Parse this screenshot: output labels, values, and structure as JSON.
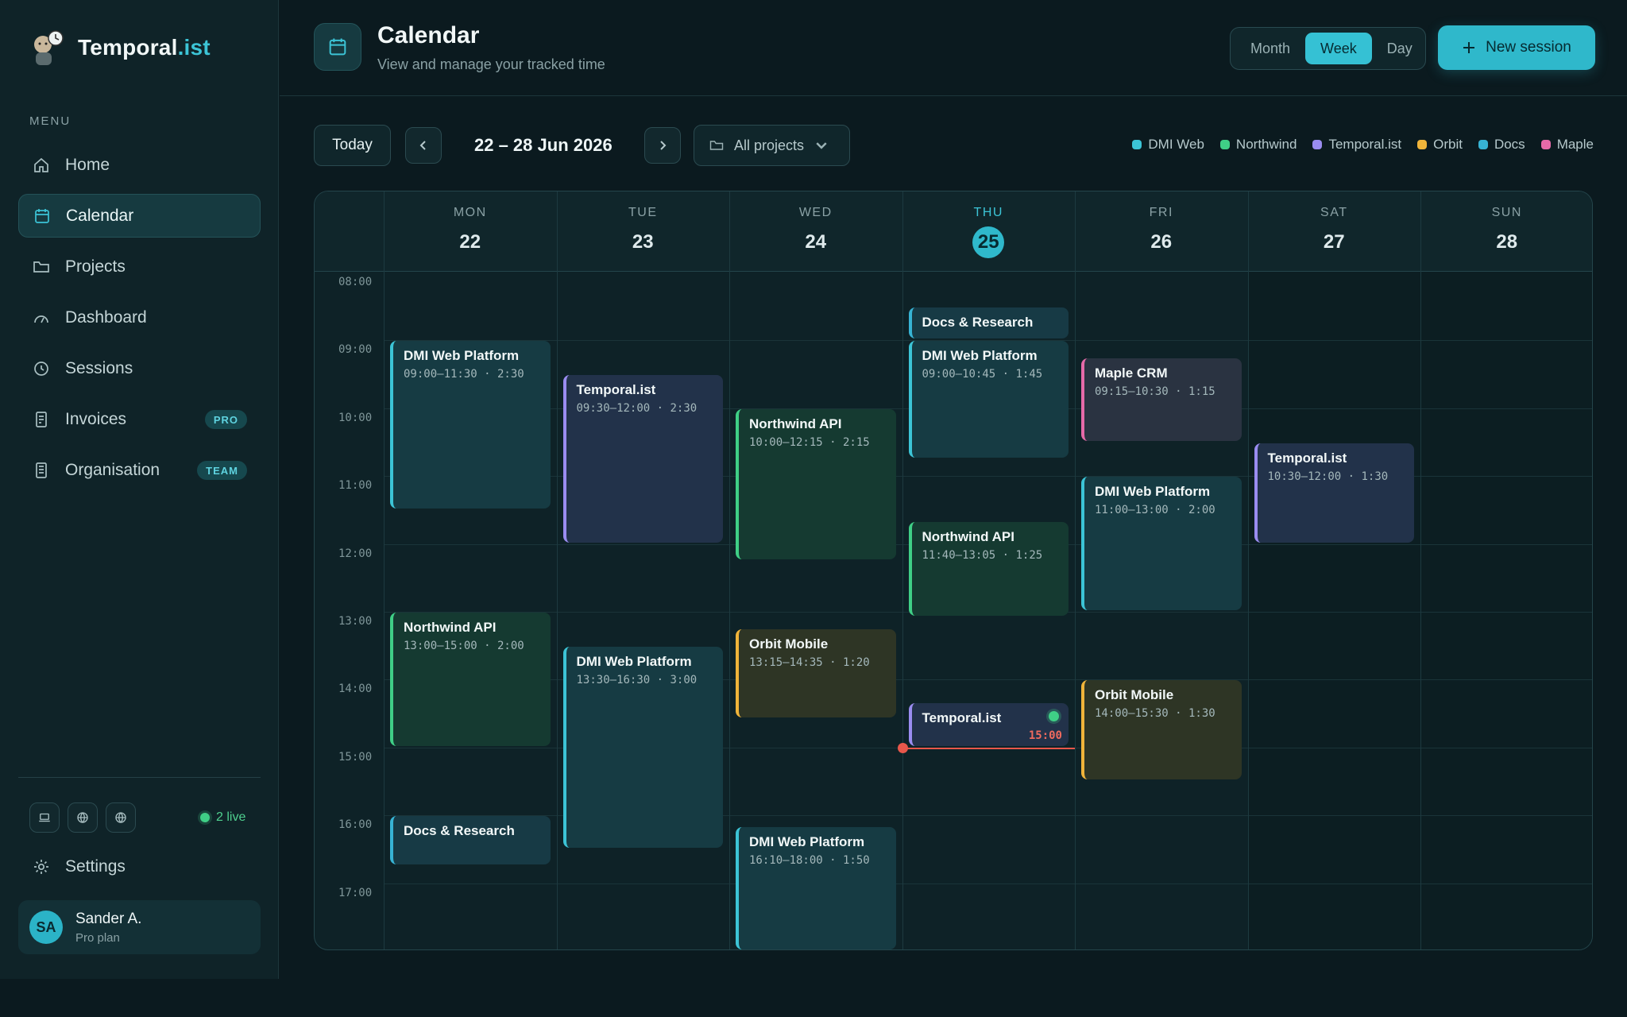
{
  "brand": {
    "name_main": "Temporal",
    "name_accent": ".ist"
  },
  "sidebar": {
    "menu_label": "MENU",
    "items": [
      {
        "label": "Home",
        "icon": "home-icon"
      },
      {
        "label": "Calendar",
        "icon": "calendar-icon",
        "active": true
      },
      {
        "label": "Projects",
        "icon": "folder-icon"
      },
      {
        "label": "Dashboard",
        "icon": "gauge-icon"
      },
      {
        "label": "Sessions",
        "icon": "clock-icon"
      },
      {
        "label": "Invoices",
        "icon": "invoice-icon",
        "badge": "PRO"
      },
      {
        "label": "Organisation",
        "icon": "building-icon",
        "badge": "TEAM"
      }
    ],
    "live_label": "2 live",
    "settings_label": "Settings",
    "user": {
      "initials": "SA",
      "name": "Sander A.",
      "plan": "Pro plan"
    }
  },
  "header": {
    "title": "Calendar",
    "subtitle": "View and manage your tracked time",
    "views": [
      "Month",
      "Week",
      "Day"
    ],
    "active_view": "Week",
    "new_session": "New session"
  },
  "toolbar": {
    "today": "Today",
    "range": "22 – 28 Jun 2026",
    "project_filter": "All projects"
  },
  "legend": [
    {
      "label": "DMI Web",
      "color": "#3cc4d6"
    },
    {
      "label": "Northwind",
      "color": "#3fcf86"
    },
    {
      "label": "Temporal.ist",
      "color": "#9a8cf0"
    },
    {
      "label": "Orbit",
      "color": "#f0b43a"
    },
    {
      "label": "Docs",
      "color": "#37b3d4"
    },
    {
      "label": "Maple",
      "color": "#e66aa8"
    }
  ],
  "calendar": {
    "days": [
      {
        "name": "MON",
        "num": "22"
      },
      {
        "name": "TUE",
        "num": "23"
      },
      {
        "name": "WED",
        "num": "24"
      },
      {
        "name": "THU",
        "num": "25",
        "today": true
      },
      {
        "name": "FRI",
        "num": "26"
      },
      {
        "name": "SAT",
        "num": "27"
      },
      {
        "name": "SUN",
        "num": "28"
      }
    ],
    "hours": [
      "08:00",
      "09:00",
      "10:00",
      "11:00",
      "12:00",
      "13:00",
      "14:00",
      "15:00",
      "16:00",
      "17:00"
    ],
    "now_time": "15:00",
    "events": [
      {
        "day": 0,
        "start": "09:00",
        "end": "11:30",
        "title": "DMI Web Platform",
        "time": "09:00–11:30 · 2:30",
        "project": "dmi"
      },
      {
        "day": 0,
        "start": "13:00",
        "end": "15:00",
        "title": "Northwind API",
        "time": "13:00–15:00 · 2:00",
        "project": "north"
      },
      {
        "day": 0,
        "start": "16:00",
        "end": "16:45",
        "title": "Docs & Research",
        "time": "",
        "project": "docs"
      },
      {
        "day": 1,
        "start": "09:30",
        "end": "12:00",
        "title": "Temporal.ist",
        "time": "09:30–12:00 · 2:30",
        "project": "temp"
      },
      {
        "day": 1,
        "start": "13:30",
        "end": "16:30",
        "title": "DMI Web Platform",
        "time": "13:30–16:30 · 3:00",
        "project": "dmi"
      },
      {
        "day": 2,
        "start": "10:00",
        "end": "12:15",
        "title": "Northwind API",
        "time": "10:00–12:15 · 2:15",
        "project": "north"
      },
      {
        "day": 2,
        "start": "13:15",
        "end": "14:35",
        "title": "Orbit Mobile",
        "time": "13:15–14:35 · 1:20",
        "project": "orbit"
      },
      {
        "day": 2,
        "start": "16:10",
        "end": "18:00",
        "title": "DMI Web Platform",
        "time": "16:10–18:00 · 1:50",
        "project": "dmi"
      },
      {
        "day": 3,
        "start": "08:30",
        "end": "09:00",
        "title": "Docs & Research",
        "time": "",
        "project": "docs"
      },
      {
        "day": 3,
        "start": "09:00",
        "end": "10:45",
        "title": "DMI Web Platform",
        "time": "09:00–10:45 · 1:45",
        "project": "dmi"
      },
      {
        "day": 3,
        "start": "11:40",
        "end": "13:05",
        "title": "Northwind API",
        "time": "11:40–13:05 · 1:25",
        "project": "north"
      },
      {
        "day": 3,
        "start": "14:20",
        "end": "15:00",
        "title": "Temporal.ist",
        "time": "",
        "project": "temp",
        "live": true
      },
      {
        "day": 4,
        "start": "09:15",
        "end": "10:30",
        "title": "Maple CRM",
        "time": "09:15–10:30 · 1:15",
        "project": "maple"
      },
      {
        "day": 4,
        "start": "11:00",
        "end": "13:00",
        "title": "DMI Web Platform",
        "time": "11:00–13:00 · 2:00",
        "project": "dmi"
      },
      {
        "day": 4,
        "start": "14:00",
        "end": "15:30",
        "title": "Orbit Mobile",
        "time": "14:00–15:30 · 1:30",
        "project": "orbit"
      },
      {
        "day": 5,
        "start": "10:30",
        "end": "12:00",
        "title": "Temporal.ist",
        "time": "10:30–12:00 · 1:30",
        "project": "temp"
      }
    ]
  }
}
